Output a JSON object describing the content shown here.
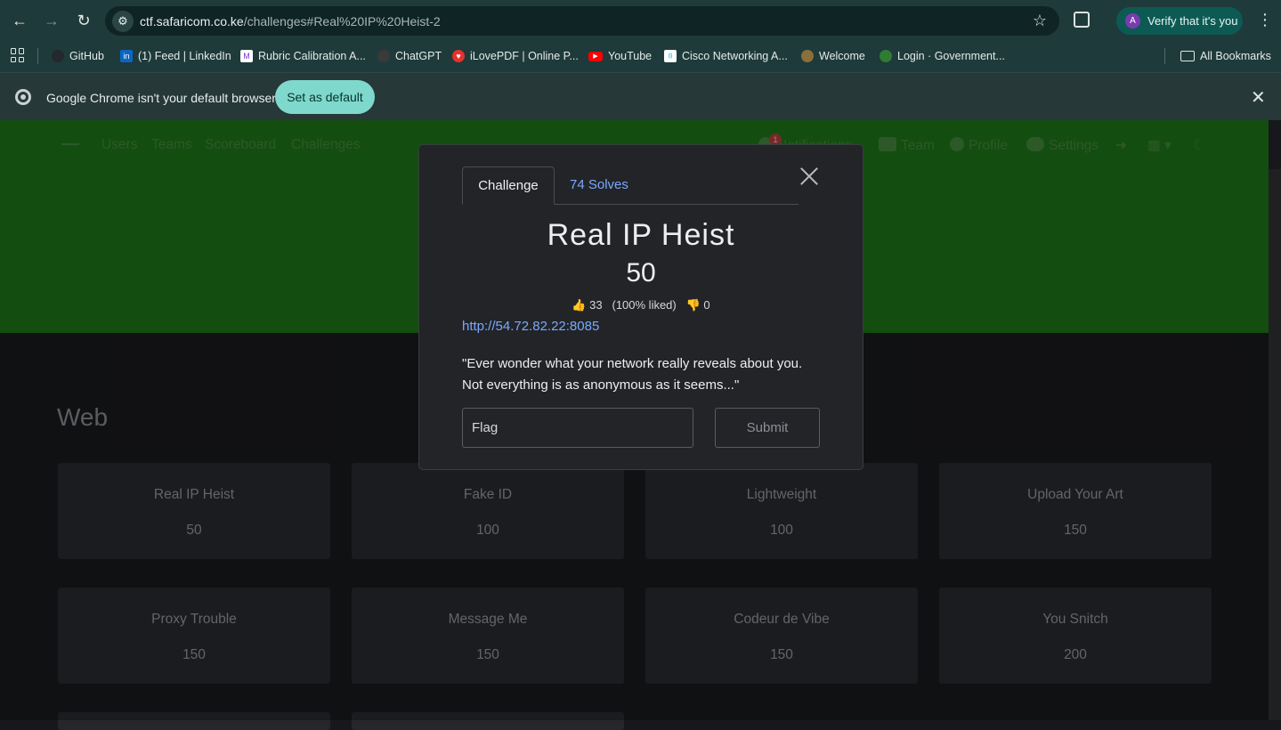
{
  "browser": {
    "url_host": "ctf.safaricom.co.ke",
    "url_path": "/challenges#Real%20IP%20Heist-2",
    "verify_label": "Verify that it's you",
    "avatar_letter": "A"
  },
  "bookmarks": [
    {
      "label": "GitHub",
      "icon": "github-icon",
      "color": "#24292e"
    },
    {
      "label": "(1) Feed | LinkedIn",
      "icon": "linkedin-icon",
      "color": "#0a66c2"
    },
    {
      "label": "Rubric Calibration A...",
      "icon": "rubric-icon",
      "color": "#6c3bd1"
    },
    {
      "label": "ChatGPT",
      "icon": "chatgpt-icon",
      "color": "#3a3a3a"
    },
    {
      "label": "iLovePDF | Online P...",
      "icon": "ilovepdf-icon",
      "color": "#e5322d"
    },
    {
      "label": "YouTube",
      "icon": "youtube-icon",
      "color": "#ff0000"
    },
    {
      "label": "Cisco Networking A...",
      "icon": "cisco-icon",
      "color": "#ffffff"
    },
    {
      "label": "Welcome",
      "icon": "welcome-icon",
      "color": "#8a6f3a"
    },
    {
      "label": "Login · Government...",
      "icon": "government-icon",
      "color": "#2e7d32"
    }
  ],
  "all_bookmarks": "All Bookmarks",
  "infobar": {
    "message": "Google Chrome isn't your default browser",
    "button": "Set as default"
  },
  "nav": {
    "left": [
      "Users",
      "Teams",
      "Scoreboard",
      "Challenges"
    ],
    "notifications": "Notifications",
    "notif_count": "1",
    "team": "Team",
    "profile": "Profile",
    "settings": "Settings"
  },
  "section": "Web",
  "challenges": [
    {
      "name": "Real IP Heist",
      "points": "50"
    },
    {
      "name": "Fake ID",
      "points": "100"
    },
    {
      "name": "Lightweight",
      "points": "100"
    },
    {
      "name": "Upload Your Art",
      "points": "150"
    },
    {
      "name": "Proxy Trouble",
      "points": "150"
    },
    {
      "name": "Message Me",
      "points": "150"
    },
    {
      "name": "Codeur de Vibe",
      "points": "150"
    },
    {
      "name": "You Snitch",
      "points": "200"
    }
  ],
  "modal": {
    "tab_challenge": "Challenge",
    "tab_solves": "74 Solves",
    "name": "Real IP Heist",
    "value": "50",
    "likes": "33",
    "liked_pct": "(100% liked)",
    "dislikes": "0",
    "link": "http://54.72.82.22:8085",
    "description": "\"Ever wonder what your network really reveals about you. Not everything is as anonymous as it seems...\"",
    "flag_placeholder": "Flag",
    "submit": "Submit"
  }
}
